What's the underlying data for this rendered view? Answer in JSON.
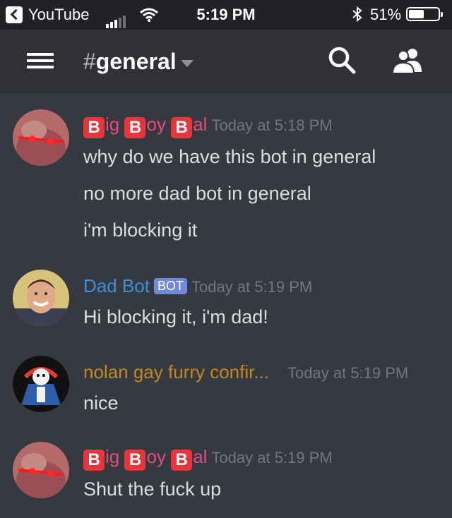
{
  "status_bar": {
    "back_app": "YouTube",
    "time": "5:19 PM",
    "battery_pct": "51%",
    "battery_level": 0.51,
    "bluetooth_icon": "bluetooth-icon",
    "wifi_icon": "wifi-icon"
  },
  "header": {
    "hash": "#",
    "channel": "general",
    "icons": [
      "hamburger-menu-icon",
      "search-icon",
      "members-icon"
    ]
  },
  "messages": [
    {
      "author": {
        "b1": "B",
        "t1": "ig",
        "b2": "B",
        "t2": "oy",
        "b3": "B",
        "t3": "al"
      },
      "timestamp": "Today at 5:18 PM",
      "lines": [
        "why do we have this bot in general",
        "no more dad bot in general",
        "i'm blocking it"
      ]
    },
    {
      "author": "Dad Bot",
      "badge": "BOT",
      "timestamp": "Today at 5:19 PM",
      "lines": [
        "Hi blocking it, i'm dad!"
      ]
    },
    {
      "author": "nolan gay furry confir...",
      "timestamp": "Today at 5:19 PM",
      "lines": [
        "nice"
      ]
    },
    {
      "author": {
        "b1": "B",
        "t1": "ig",
        "b2": "B",
        "t2": "oy",
        "b3": "B",
        "t3": "al"
      },
      "timestamp": "Today at 5:19 PM",
      "lines": [
        "Shut the fuck up"
      ]
    }
  ],
  "colors": {
    "background": "#36393f",
    "header": "#2f3136",
    "big_boy_name": "#e14d7e",
    "dad_bot_name": "#3f8fd6",
    "nolan_name": "#c28a1e",
    "bot_badge": "#7289da"
  }
}
